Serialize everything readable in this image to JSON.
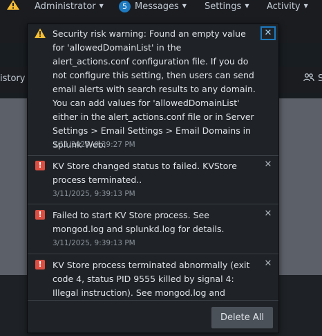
{
  "topnav": {
    "administrator_label": "Administrator",
    "messages_count": "5",
    "messages_label": "Messages",
    "settings_label": "Settings",
    "activity_label": "Activity"
  },
  "subnav": {
    "left_label": "istory",
    "right_label": "S"
  },
  "messages": [
    {
      "severity": "warning",
      "text": "Security risk warning: Found an empty value for 'allowedDomainList' in the alert_actions.conf configuration file. If you do not configure this setting, then users can send email alerts with search results to any domain. You can add values for 'allowedDomainList' either in the alert_actions.conf file or in Server Settings > Email Settings > Email Domains in Splunk Web.",
      "time": "3/11/2025, 9:39:27 PM"
    },
    {
      "severity": "error",
      "text": "KV Store changed status to failed. KVStore process terminated..",
      "time": "3/11/2025, 9:39:13 PM"
    },
    {
      "severity": "error",
      "text": "Failed to start KV Store process. See mongod.log and splunkd.log for details.",
      "time": "3/11/2025, 9:39:13 PM"
    },
    {
      "severity": "error",
      "text": "KV Store process terminated abnormally (exit code 4, status PID 9555 killed by signal 4: Illegal instruction). See mongod.log and",
      "time": ""
    }
  ],
  "footer": {
    "delete_all_label": "Delete All"
  },
  "icons": {
    "warning": "warning-triangle-icon",
    "error": "error-exclamation-icon",
    "close": "close-icon"
  },
  "colors": {
    "accent": "#1e7ac0",
    "error": "#dc4e41",
    "warning": "#f8be34"
  }
}
